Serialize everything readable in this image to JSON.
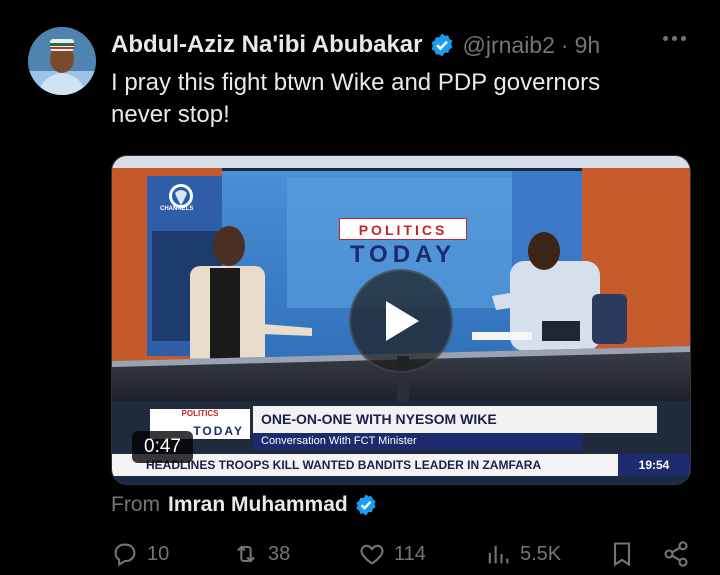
{
  "author": {
    "name": "Abdul-Aziz Na'ibi Abubakar",
    "handle": "@jrnaib2",
    "separator": "·",
    "time": "9h"
  },
  "tweet": {
    "text_line1": "I pray this fight btwn Wike and PDP governors",
    "text_line2": "never stop!"
  },
  "video": {
    "duration": "0:47",
    "channel": "CHANNELS",
    "set_sign_top": "POLITICS",
    "set_sign_bottom": "TODAY",
    "lower_third_title": "ONE-ON-ONE WITH NYESOM WIKE",
    "lower_third_subtitle": "Conversation With FCT Minister",
    "lower_third_logo_top": "POLITICS",
    "lower_third_logo": "TODAY",
    "ticker": "HEADLINES  TROOPS KILL WANTED BANDITS LEADER IN ZAMFARA",
    "ticker_time": "19:54"
  },
  "attribution": {
    "label": "From",
    "name": "Imran Muhammad"
  },
  "actions": {
    "replies": "10",
    "reposts": "38",
    "likes": "114",
    "views": "5.5K"
  },
  "colors": {
    "verified": "#1d9bf0",
    "muted": "#71767b",
    "text": "#e7e9ea",
    "background": "#000000"
  },
  "icons": [
    "more-icon",
    "verified-badge-icon",
    "play-icon",
    "reply-icon",
    "repost-icon",
    "like-icon",
    "views-icon",
    "bookmark-icon",
    "share-icon"
  ]
}
